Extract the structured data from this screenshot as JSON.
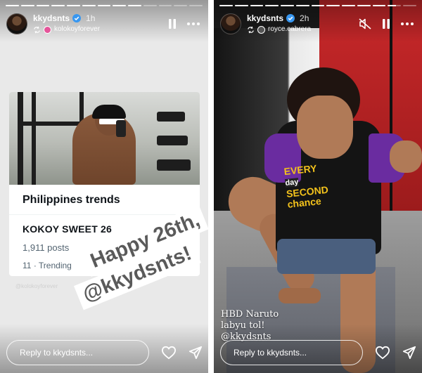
{
  "stories": [
    {
      "username": "kkydsnts",
      "time": "1h",
      "reposted_from": "kolokoyforever",
      "controls": [
        "pause-icon",
        "more-icon"
      ],
      "progress": [
        1,
        1,
        1,
        1,
        1,
        1,
        1,
        1,
        1,
        0,
        0,
        0,
        0
      ],
      "card": {
        "title": "Philippines trends",
        "trend_name": "KOKOY SWEET 26",
        "posts": "1,911 posts",
        "rank": "11",
        "rank_suffix": "· Trending"
      },
      "watermark": "@kolokoyforever",
      "sticker_line1": "Happy 26th,",
      "sticker_line2": "@kkydsnts!",
      "reply_placeholder": "Reply to kkydsnts...",
      "actions": [
        "heart-icon",
        "send-icon"
      ]
    },
    {
      "username": "kkydsnts",
      "time": "2h",
      "reposted_from": "royce.cabrera",
      "controls": [
        "mute-icon",
        "pause-icon",
        "more-icon"
      ],
      "progress": [
        1,
        1,
        1,
        1,
        1,
        1,
        1,
        1,
        1,
        1,
        1,
        0.6,
        0
      ],
      "shirt_print": {
        "line1": "EVERY",
        "line2": "day",
        "line3": "SECOND",
        "line4": "chance"
      },
      "caption": {
        "line1": "HBD Naruto",
        "line2": "labyu tol!",
        "line3": "@kkydsnts"
      },
      "reply_placeholder": "Reply to kkydsnts...",
      "actions": [
        "heart-icon",
        "send-icon"
      ]
    }
  ],
  "colors": {
    "verified": "#3897f0",
    "card_bg": "#ffffff",
    "trend_gray": "#536471",
    "sticker_text": "#5a5a5a",
    "shirt_yellow": "#f3c21c",
    "sleeve_purple": "#6a2ca0",
    "backdrop_red": "#c8282a"
  }
}
